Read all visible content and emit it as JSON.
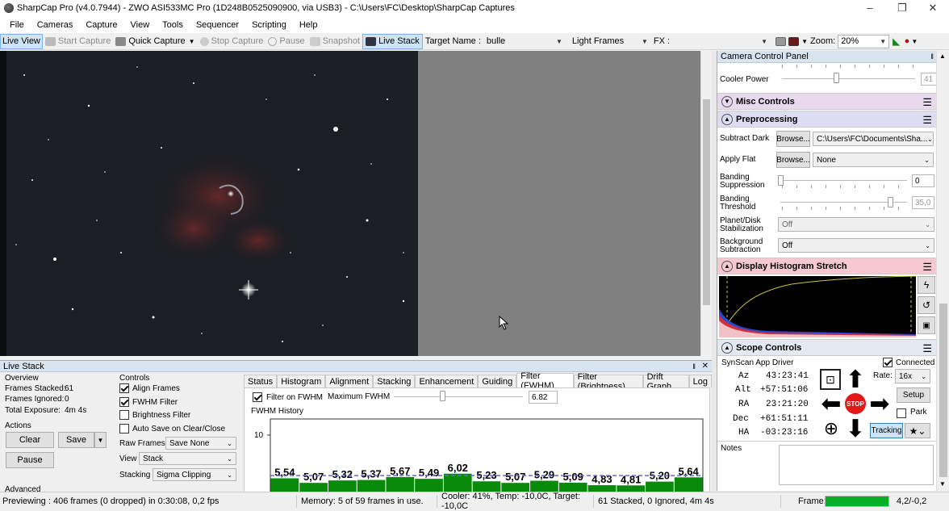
{
  "window": {
    "title": "SharpCap Pro (v4.0.7944) - ZWO ASI533MC Pro (1D248B0525090900, via USB3) - C:\\Users\\FC\\Desktop\\SharpCap Captures",
    "min": "–",
    "max": "❐",
    "close": "✕"
  },
  "menu": [
    "File",
    "Cameras",
    "Capture",
    "View",
    "Tools",
    "Sequencer",
    "Scripting",
    "Help"
  ],
  "toolbar": {
    "live_view": "Live View",
    "start_capture": "Start Capture",
    "quick_capture": "Quick Capture",
    "stop_capture": "Stop Capture",
    "pause": "Pause",
    "snapshot": "Snapshot",
    "live_stack": "Live Stack",
    "target_label": "Target Name :",
    "target_value": "bulle",
    "frame_type": "Light Frames",
    "fx_label": "FX :",
    "fx_value": "",
    "zoom_label": "Zoom:",
    "zoom_value": "20%"
  },
  "camera_panel": {
    "title": "Camera Control Panel",
    "pin": "‖",
    "cooler_power_label": "Cooler Power",
    "cooler_power_value": "41",
    "cooler_power_level": 0.41,
    "misc_controls": "Misc Controls",
    "preprocessing": "Preprocessing",
    "subtract_dark_label": "Subtract Dark",
    "browse": "Browse...",
    "subtract_dark_value": "C:\\Users\\FC\\Documents\\Sha...",
    "apply_flat_label": "Apply Flat",
    "apply_flat_value": "None",
    "banding_suppression_label": [
      "Banding",
      "Suppression"
    ],
    "banding_suppression_value": "0",
    "banding_threshold_label": [
      "Banding",
      "Threshold"
    ],
    "banding_threshold_value": "35,0",
    "planet_disk_label": [
      "Planet/Disk",
      "Stabilization"
    ],
    "planet_disk_value": "Off",
    "background_sub_label": [
      "Background",
      "Subtraction"
    ],
    "background_sub_value": "Off",
    "display_histogram": "Display Histogram Stretch",
    "scope_controls": "Scope Controls",
    "scope_driver": "SynScan App Driver",
    "connected_label": "Connected",
    "az_label": "Az",
    "az_value": "43:23:41",
    "alt_label": "Alt",
    "alt_value": "+57:51:06",
    "ra_label": "RA",
    "ra_value": "23:21:20",
    "dec_label": "Dec",
    "dec_value": "+61:51:11",
    "ha_label": "HA",
    "ha_value": "-03:23:16",
    "rate_label": "Rate:",
    "rate_value": "16x",
    "setup": "Setup",
    "park": "Park",
    "tracking": "Tracking",
    "stop": "STOP",
    "notes_label": "Notes"
  },
  "live_stack": {
    "title": "Live Stack",
    "pin": "‖",
    "close": "✕",
    "overview_label": "Overview",
    "frames_stacked_label": "Frames Stacked:",
    "frames_stacked_value": "61",
    "frames_ignored_label": "Frames Ignored:",
    "frames_ignored_value": "0",
    "total_exposure_label": "Total Exposure:",
    "total_exposure_value": "4m 4s",
    "actions_label": "Actions",
    "clear": "Clear",
    "save": "Save",
    "pause": "Pause",
    "advanced": "Advanced",
    "controls_label": "Controls",
    "align_frames": "Align Frames",
    "fwhm_filter": "FWHM Filter",
    "brightness_filter": "Brightness Filter",
    "auto_save": "Auto Save on Clear/Close",
    "raw_frames_label": "Raw Frames",
    "raw_frames_value": "Save None",
    "view_label": "View",
    "view_value": "Stack",
    "stacking_label": "Stacking",
    "stacking_value": "Sigma Clipping",
    "tabs": [
      "Status",
      "Histogram",
      "Alignment",
      "Stacking",
      "Enhancement",
      "Guiding",
      "Filter (FWHM)",
      "Filter (Brightness)",
      "Drift Graph",
      "Log"
    ],
    "filter_on_fwhm": "Filter on FWHM",
    "max_fwhm_label": "Maximum FWHM",
    "max_fwhm_value": "6.82",
    "fwhm_history_label": "FWHM History",
    "y_tick": "10"
  },
  "chart_data": {
    "type": "bar",
    "title": "FWHM History",
    "values": [
      5.54,
      5.07,
      5.32,
      5.37,
      5.67,
      5.49,
      6.02,
      5.23,
      5.07,
      5.29,
      5.09,
      4.83,
      4.81,
      5.2,
      5.64
    ],
    "labels": [
      "5,54",
      "5,07",
      "5,32",
      "5,37",
      "5,67",
      "5,49",
      "6,02",
      "5,23",
      "5,07",
      "5,29",
      "5,09",
      "4,83",
      "4,81",
      "5,20",
      "5,64"
    ],
    "yticks": [
      10
    ],
    "threshold": 6.82,
    "bar_color": "#0a8a0a",
    "threshold_color": "#6666dd"
  },
  "status": {
    "preview": "Previewing : 406 frames (0 dropped) in 0:30:08, 0,2 fps",
    "memory": "Memory: 5 of 59 frames in use.",
    "cooler": "Cooler: 41%, Temp: -10,0C, Target: -10,0C",
    "stacked": "61 Stacked, 0 Ignored, 4m 4s",
    "frame_label": "Frame:",
    "frame_progress": 1.0,
    "offset": "4,2/-0,2"
  },
  "colors": {
    "misc_header": "#e8d9ee",
    "preprocessing_header": "#dedcf3",
    "histogram_header": "#f6c9d2",
    "scope_header": "#e2e9f1",
    "live_stack_button_highlight": "#cce4f7"
  }
}
